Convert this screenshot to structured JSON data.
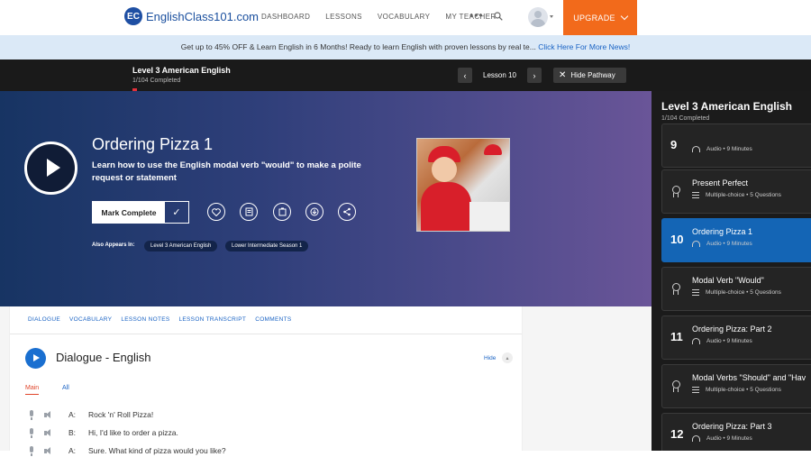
{
  "nav": {
    "logo_mark": "EC",
    "logo_text": "EnglishClass101.com",
    "links": [
      "DASHBOARD",
      "LESSONS",
      "VOCABULARY",
      "MY TEACHER"
    ],
    "more": "•••",
    "upgrade": "UPGRADE"
  },
  "promo": {
    "text": "Get up to 45% OFF & Learn English in 6 Months! Ready to learn English with proven lessons by real te...",
    "link": "Click Here For More News!"
  },
  "pathbar": {
    "title": "Level 3 American English",
    "completed": "1/104 Completed",
    "progress_fraction": 0.01,
    "prev": "‹",
    "lesson": "Lesson 10",
    "next": "›",
    "hide_pathway": "Hide Pathway"
  },
  "hero": {
    "title": "Ordering Pizza 1",
    "description": "Learn how to use the English modal verb \"would\" to make a polite request or statement",
    "mark_complete": "Mark Complete",
    "also_appears_in": "Also Appears In:",
    "chips": [
      "Level 3 American English",
      "Lower Intermediate Season 1"
    ],
    "actions": [
      "heart-icon",
      "notes-icon",
      "flashcard-icon",
      "download-icon",
      "share-icon"
    ]
  },
  "tabs": [
    "DIALOGUE",
    "VOCABULARY",
    "LESSON NOTES",
    "LESSON TRANSCRIPT",
    "COMMENTS"
  ],
  "dialogue": {
    "title": "Dialogue - English",
    "hide": "Hide",
    "tab_main": "Main",
    "tab_all": "All",
    "lines": [
      {
        "speaker": "A:",
        "text": "Rock 'n' Roll Pizza!"
      },
      {
        "speaker": "B:",
        "text": "Hi, I'd like to order a pizza."
      },
      {
        "speaker": "A:",
        "text": "Sure. What kind of pizza would you like?"
      }
    ]
  },
  "sidebar": {
    "title": "Level 3 American English",
    "completed": "1/104 Completed",
    "progress_fraction": 0.01,
    "items": [
      {
        "num": "9",
        "title": "",
        "meta": "Audio • 9 Minutes",
        "kind": "audio",
        "active": false
      },
      {
        "num": "",
        "title": "Present Perfect",
        "meta": "Multiple-choice • 5 Questions",
        "kind": "quiz",
        "active": false
      },
      {
        "num": "10",
        "title": "Ordering Pizza 1",
        "meta": "Audio • 9 Minutes",
        "kind": "audio",
        "active": true
      },
      {
        "num": "",
        "title": "Modal Verb \"Would\"",
        "meta": "Multiple-choice • 5 Questions",
        "kind": "quiz",
        "active": false
      },
      {
        "num": "11",
        "title": "Ordering Pizza: Part 2",
        "meta": "Audio • 9 Minutes",
        "kind": "audio",
        "active": false
      },
      {
        "num": "",
        "title": "Modal Verbs \"Should\" and \"Hav",
        "meta": "Multiple-choice • 5 Questions",
        "kind": "quiz",
        "active": false
      },
      {
        "num": "12",
        "title": "Ordering Pizza: Part 3",
        "meta": "Audio • 9 Minutes",
        "kind": "audio",
        "active": false
      }
    ]
  },
  "colors": {
    "accent": "#1a63c4",
    "upgrade": "#f26a1b",
    "active_card": "#1465b5",
    "progress": "#e2303b"
  }
}
